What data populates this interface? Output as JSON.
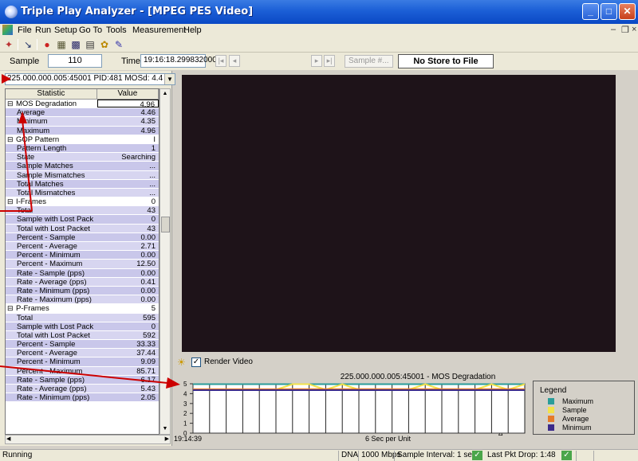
{
  "window": {
    "title": "Triple Play Analyzer - [MPEG PES Video]"
  },
  "menu": [
    "File",
    "Run",
    "Setup",
    "Go To",
    "Tools",
    "Measurement",
    "Help"
  ],
  "sample_bar": {
    "sample_label": "Sample",
    "sample_value": "110",
    "time_label": "Time",
    "time_value": "19:16:18.299832000",
    "sample_hash_button": "Sample #...",
    "store_status": "No Store to File"
  },
  "stream_selector": {
    "value": "225.000.000.005:45001  PID:481  MOSd: 4.4"
  },
  "grid": {
    "headers": [
      "Statistic",
      "Value"
    ],
    "rows": [
      {
        "label": "MOS Degradation",
        "value": "4.96",
        "type": "group"
      },
      {
        "label": "Average",
        "value": "4.46",
        "type": "child"
      },
      {
        "label": "Minimum",
        "value": "4.35",
        "type": "child"
      },
      {
        "label": "Maximum",
        "value": "4.96",
        "type": "child"
      },
      {
        "label": "GOP Pattern",
        "value": "I",
        "type": "group"
      },
      {
        "label": "Pattern Length",
        "value": "1",
        "type": "child"
      },
      {
        "label": "State",
        "value": "Searching",
        "type": "child"
      },
      {
        "label": "Sample Matches",
        "value": "...",
        "type": "child"
      },
      {
        "label": "Sample Mismatches",
        "value": "...",
        "type": "child"
      },
      {
        "label": "Total Matches",
        "value": "...",
        "type": "child"
      },
      {
        "label": "Total Mismatches",
        "value": "...",
        "type": "child"
      },
      {
        "label": "I-Frames",
        "value": "0",
        "type": "group"
      },
      {
        "label": "Total",
        "value": "43",
        "type": "child"
      },
      {
        "label": "Sample with Lost Pack",
        "value": "0",
        "type": "child"
      },
      {
        "label": "Total with Lost Packet",
        "value": "43",
        "type": "child"
      },
      {
        "label": "Percent - Sample",
        "value": "0.00",
        "type": "child"
      },
      {
        "label": "Percent - Average",
        "value": "2.71",
        "type": "child"
      },
      {
        "label": "Percent - Minimum",
        "value": "0.00",
        "type": "child"
      },
      {
        "label": "Percent - Maximum",
        "value": "12.50",
        "type": "child"
      },
      {
        "label": "Rate - Sample (pps)",
        "value": "0.00",
        "type": "child"
      },
      {
        "label": "Rate - Average (pps)",
        "value": "0.41",
        "type": "child"
      },
      {
        "label": "Rate - Minimum (pps)",
        "value": "0.00",
        "type": "child"
      },
      {
        "label": "Rate - Maximum (pps)",
        "value": "0.00",
        "type": "child"
      },
      {
        "label": "P-Frames",
        "value": "5",
        "type": "group"
      },
      {
        "label": "Total",
        "value": "595",
        "type": "child"
      },
      {
        "label": "Sample with Lost Pack",
        "value": "0",
        "type": "child"
      },
      {
        "label": "Total with Lost Packet",
        "value": "592",
        "type": "child"
      },
      {
        "label": "Percent - Sample",
        "value": "33.33",
        "type": "child"
      },
      {
        "label": "Percent - Average",
        "value": "37.44",
        "type": "child"
      },
      {
        "label": "Percent - Minimum",
        "value": "9.09",
        "type": "child"
      },
      {
        "label": "Percent - Maximum",
        "value": "85.71",
        "type": "child"
      },
      {
        "label": "Rate - Sample (pps)",
        "value": "6.17",
        "type": "child"
      },
      {
        "label": "Rate - Average (pps)",
        "value": "5.43",
        "type": "child"
      },
      {
        "label": "Rate - Minimum (pps)",
        "value": "2.05",
        "type": "child"
      }
    ]
  },
  "video": {
    "render_video_label": "Render Video",
    "render_video_checked": "✓"
  },
  "chart_data": {
    "type": "line",
    "title": "225.000.000.005:45001 - MOS Degradation",
    "xlabel": "6 Sec per Unit",
    "x_start_label": "19:14:39",
    "yticks": [
      "5",
      "4",
      "3",
      "2",
      "1",
      "0"
    ],
    "ylim": [
      0,
      5
    ],
    "x": [
      0,
      1,
      2,
      3,
      4,
      5,
      6,
      7,
      8,
      9,
      10,
      11,
      12,
      13,
      14,
      15,
      16,
      17,
      18,
      19,
      20
    ],
    "series": [
      {
        "name": "Maximum",
        "color": "#2a9d9a",
        "values": [
          4.96,
          4.96,
          4.96,
          4.96,
          4.96,
          4.96,
          4.96,
          4.96,
          4.96,
          4.96,
          4.96,
          4.96,
          4.96,
          4.96,
          4.96,
          4.96,
          4.96,
          4.96,
          4.96,
          4.96,
          4.96
        ]
      },
      {
        "name": "Sample",
        "color": "#f2e24a",
        "values": [
          4.4,
          4.4,
          4.4,
          4.4,
          4.4,
          4.4,
          4.96,
          4.96,
          4.4,
          4.96,
          4.4,
          4.4,
          4.4,
          4.4,
          4.96,
          4.4,
          4.4,
          4.4,
          4.96,
          4.4,
          4.96
        ]
      },
      {
        "name": "Average",
        "color": "#e67b2a",
        "values": [
          4.45,
          4.45,
          4.45,
          4.45,
          4.45,
          4.45,
          4.46,
          4.46,
          4.46,
          4.46,
          4.46,
          4.46,
          4.46,
          4.46,
          4.46,
          4.46,
          4.46,
          4.46,
          4.46,
          4.46,
          4.46
        ]
      },
      {
        "name": "Minimum",
        "color": "#3b2a8a",
        "values": [
          4.35,
          4.35,
          4.35,
          4.35,
          4.35,
          4.35,
          4.35,
          4.35,
          4.35,
          4.35,
          4.35,
          4.35,
          4.35,
          4.35,
          4.35,
          4.35,
          4.35,
          4.35,
          4.35,
          4.35,
          4.35
        ]
      }
    ],
    "legend_title": "Legend",
    "legend_position": "right",
    "grid": true
  },
  "status": {
    "left": "Running",
    "dna": "DNA",
    "speed": "1000 Mbps",
    "interval": "Sample Interval: 1 sec",
    "drop": "Last Pkt Drop: 1:48"
  }
}
